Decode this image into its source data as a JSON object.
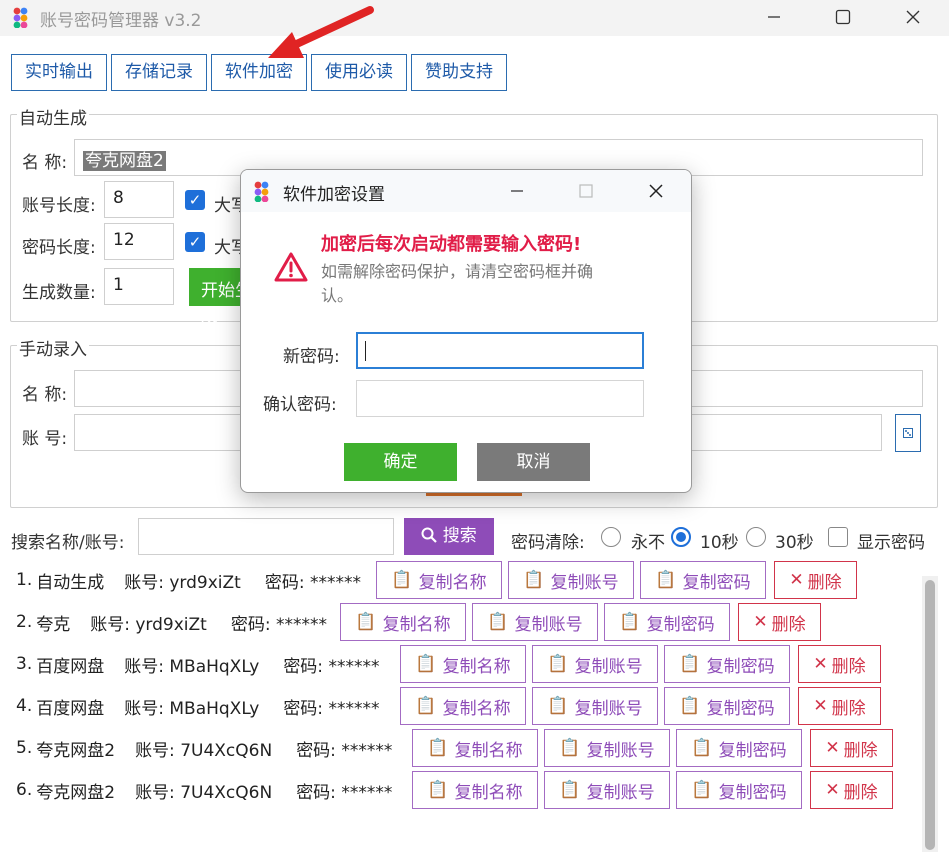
{
  "app": {
    "title": "账号密码管理器 v3.2"
  },
  "tabs": [
    {
      "label": "实时输出"
    },
    {
      "label": "存储记录"
    },
    {
      "label": "软件加密"
    },
    {
      "label": "使用必读"
    },
    {
      "label": "赞助支持"
    }
  ],
  "auto_gen": {
    "group_title": "自动生成",
    "name_label": "名 称:",
    "name_value": "夸克网盘2",
    "account_len_label": "账号长度:",
    "account_len_value": "8",
    "password_len_label": "密码长度:",
    "password_len_value": "12",
    "count_label": "生成数量:",
    "count_value": "1",
    "uppercase_label_1": "大写",
    "uppercase_label_2": "大写",
    "start_button": "开始生成"
  },
  "manual": {
    "group_title": "手动录入",
    "name_label": "名 称:",
    "account_label": "账 号:"
  },
  "search": {
    "label": "搜索名称/账号:",
    "button": "搜索",
    "clear_label": "密码清除:",
    "opt_never": "永不",
    "opt_10s": "10秒",
    "opt_30s": "30秒",
    "show_password": "显示密码"
  },
  "records": [
    {
      "index": "1.",
      "name": "自动生成",
      "account": "账号: yrd9xiZt",
      "password": "密码: ******"
    },
    {
      "index": "2.",
      "name": "夸克",
      "account": "账号: yrd9xiZt",
      "password": "密码: ******"
    },
    {
      "index": "3.",
      "name": "百度网盘",
      "account": "账号: MBaHqXLy",
      "password": "密码: ******"
    },
    {
      "index": "4.",
      "name": "百度网盘",
      "account": "账号: MBaHqXLy",
      "password": "密码: ******"
    },
    {
      "index": "5.",
      "name": "夸克网盘2",
      "account": "账号: 7U4XcQ6N",
      "password": "密码: ******"
    },
    {
      "index": "6.",
      "name": "夸克网盘2",
      "account": "账号: 7U4XcQ6N",
      "password": "密码: ******"
    }
  ],
  "row_buttons": {
    "copy_name": "复制名称",
    "copy_account": "复制账号",
    "copy_password": "复制密码",
    "delete": "删除"
  },
  "dialog": {
    "title": "软件加密设置",
    "warning_title": "加密后每次启动都需要输入密码!",
    "warning_text": "如需解除密码保护，请清空密码框并确认。",
    "new_password_label": "新密码:",
    "confirm_password_label": "确认密码:",
    "ok_button": "确定",
    "cancel_button": "取消"
  },
  "colors": {
    "accent_blue": "#1e6fd9",
    "purple": "#8e4cb8",
    "green": "#3fb02e",
    "red": "#d1344a",
    "arrow": "#e02424"
  }
}
